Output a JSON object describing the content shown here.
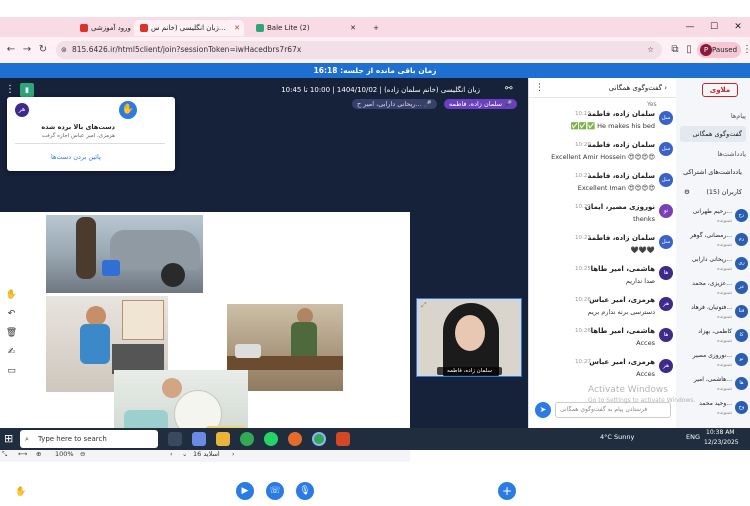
{
  "browser": {
    "tabs": [
      {
        "label": "ورود آموزشی"
      },
      {
        "label": "زبان انگلیسی (خانم س... "
      },
      {
        "label": "Bale Lite (2)"
      }
    ],
    "new_tab": "+",
    "url": "815.6426.ir/html5client/join?sessionToken=iwHacedbrs7r67x",
    "profile_label": "Paused",
    "profile_initial": "P"
  },
  "session": {
    "timer_text": "زمان باقی مانده از جلسه: 16:18",
    "title": "زبان انگلیسی (خانم سلمان زاده) | 1404/10/02 | 10:00 تا 10:45",
    "presenter_chip": "سلمان زاده، فاطمه",
    "speaker_chip": "ریحانی دارابی، امیر ح...",
    "slide_label": "اسلاید 16",
    "zoom": "100%"
  },
  "permission_popup": {
    "title": "دست‌های بالا برده شده",
    "subtitle": "هرمزی، امیر عباس اجازه گرفت",
    "action": "پائین بردن دست‌ها",
    "avatar": "هر"
  },
  "video": {
    "name": "سلمان زاده، فاطمه"
  },
  "chat": {
    "title": "گفت‌وگوی همگانی",
    "input_placeholder": "فرستادن پیام به گفت‌وگوی همگانی",
    "top_text": "Yes",
    "messages": [
      {
        "avatar": "سل",
        "color": "#3a62c9",
        "name": "سلمان زاده، فاطمه",
        "time": "10:19",
        "text": "✅✅✅ He makes his bed"
      },
      {
        "avatar": "سل",
        "color": "#3a62c9",
        "name": "سلمان زاده، فاطمه",
        "time": "10:20",
        "text": "Excellent Amir Hossein 😍😍😍😍"
      },
      {
        "avatar": "سل",
        "color": "#3a62c9",
        "name": "سلمان زاده، فاطمه",
        "time": "10:21",
        "text": "Excellent Iman 😍😍😍😍"
      },
      {
        "avatar": "نو",
        "color": "#7b3fb5",
        "name": "نوروزی مصیر، ایمان",
        "time": "10:22",
        "text": "thenks"
      },
      {
        "avatar": "سل",
        "color": "#3a62c9",
        "name": "سلمان زاده، فاطمه",
        "time": "10:23",
        "text": "🖤🖤🖤"
      },
      {
        "avatar": "ها",
        "color": "#3d2a8a",
        "name": "هاشمی، امیر طاها",
        "time": "10:25",
        "text": "صدا نداریم"
      },
      {
        "avatar": "هر",
        "color": "#3d2a8a",
        "name": "هرمزی، امیر عباس",
        "time": "10:26",
        "text": "دسترسی برنه ندارم بریم"
      },
      {
        "avatar": "ها",
        "color": "#3d2a8a",
        "name": "هاشمی، امیر طاها",
        "time": "10:26",
        "text": "Acces"
      },
      {
        "avatar": "هر",
        "color": "#3d2a8a",
        "name": "هرمزی، امیر عباس",
        "time": "10:27",
        "text": "Acces"
      }
    ]
  },
  "sidebar": {
    "logo": "ملاوی",
    "section_messages": "پیام‌ها",
    "public_chat": "گفت‌وگوی همگانی",
    "section_notes": "یادداشت‌ها",
    "shared_notes": "یادداشت‌های اشتراکی",
    "users_label": "کاربران (15)",
    "participants": [
      {
        "avatar": "رح",
        "name": "رحیم طهرانی...",
        "role": "شنونده"
      },
      {
        "avatar": "رم",
        "name": "رمضانی، گوهر...",
        "role": "شنونده"
      },
      {
        "avatar": "ری",
        "name": "ریحانی دارابی...",
        "role": "شنونده"
      },
      {
        "avatar": "عز",
        "name": "عزیزی، محمد...",
        "role": "شنونده"
      },
      {
        "avatar": "فتا",
        "name": "فتوتیان، فرهاد...",
        "role": "شنونده"
      },
      {
        "avatar": "کا",
        "name": "کاظمی، بهزاد",
        "role": "شنونده"
      },
      {
        "avatar": "نو",
        "name": "نوروزی مصیر...",
        "role": "شنونده"
      },
      {
        "avatar": "ها",
        "name": "هاشمی، امیر...",
        "role": "شنونده"
      },
      {
        "avatar": "وح",
        "name": "وحید محمد...",
        "role": "شنونده"
      }
    ]
  },
  "watermark": {
    "line1": "Activate Windows",
    "line2": "Go to Settings to activate Windows."
  },
  "taskbar": {
    "search": "Type here to search",
    "weather": "4°C Sunny",
    "lang": "ENG",
    "time": "10:38 AM",
    "date": "12/23/2025"
  }
}
